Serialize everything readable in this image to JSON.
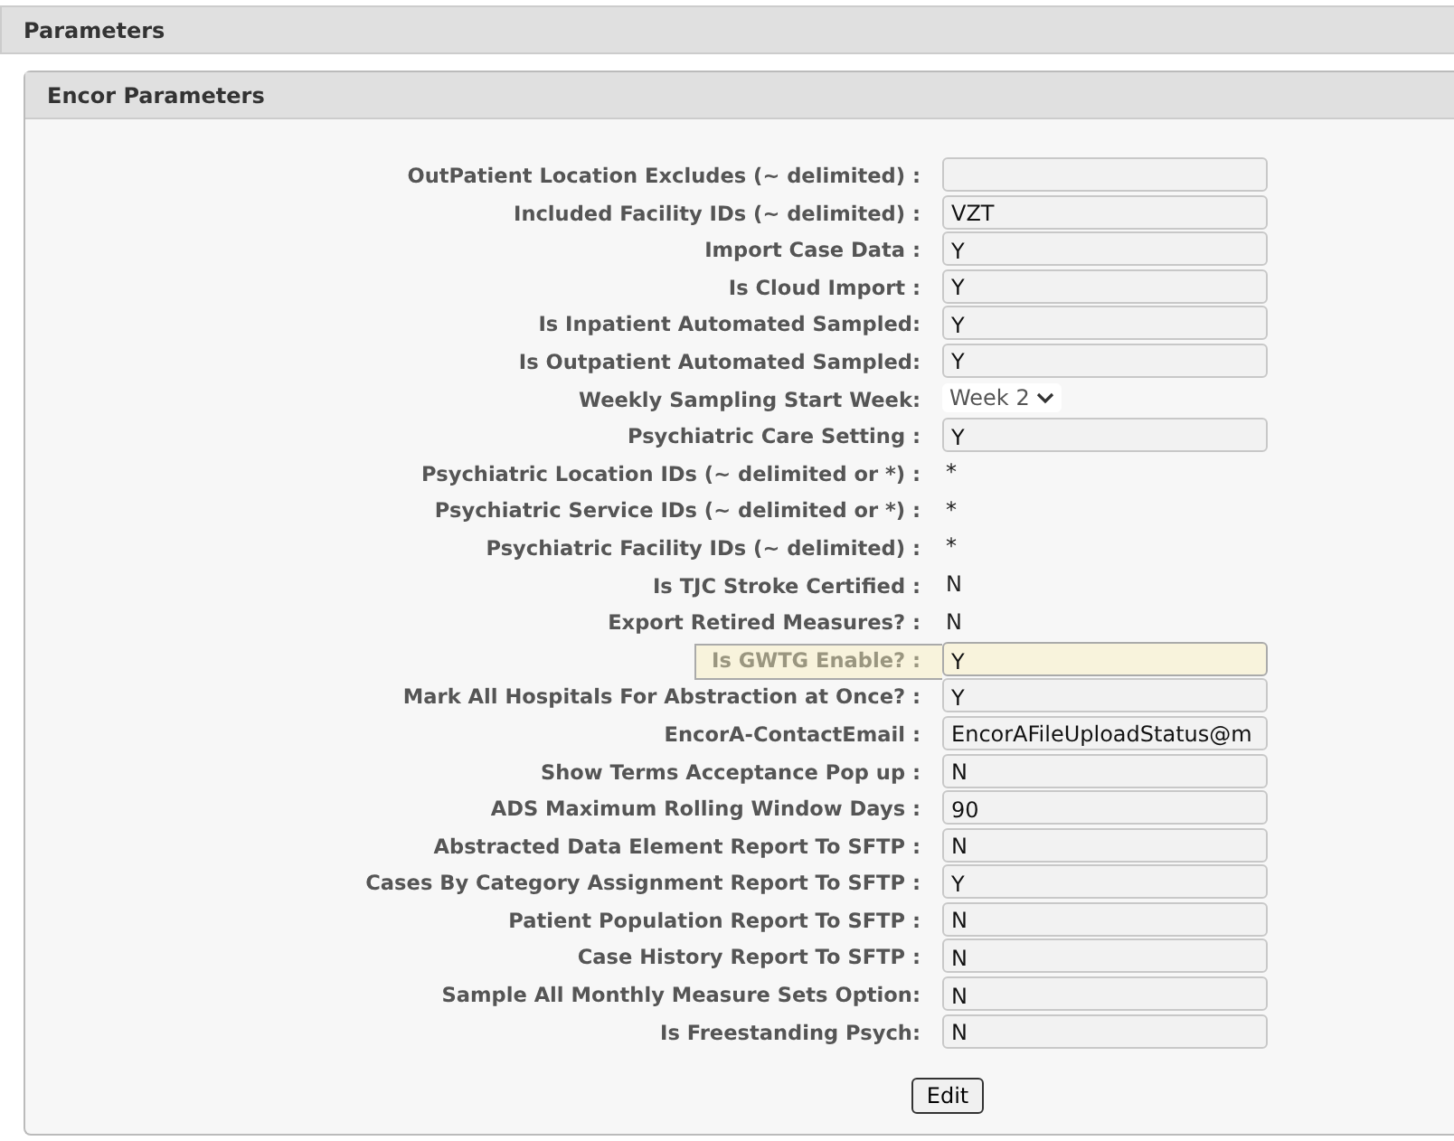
{
  "page_title": "Parameters",
  "panel": {
    "title": "Encor Parameters",
    "rows": [
      {
        "label": "OutPatient Location Excludes (~ delimited) :",
        "kind": "input",
        "value": "",
        "highlighted": false
      },
      {
        "label": "Included Facility IDs (~ delimited) :",
        "kind": "input",
        "value": "VZT",
        "highlighted": false
      },
      {
        "label": "Import Case Data :",
        "kind": "input",
        "value": "Y",
        "highlighted": false
      },
      {
        "label": "Is Cloud Import :",
        "kind": "input",
        "value": "Y",
        "highlighted": false
      },
      {
        "label": "Is Inpatient Automated Sampled:",
        "kind": "input",
        "value": "Y",
        "highlighted": false
      },
      {
        "label": "Is Outpatient Automated Sampled:",
        "kind": "input",
        "value": "Y",
        "highlighted": false
      },
      {
        "label": "Weekly Sampling Start Week:",
        "kind": "select",
        "value": "Week 2",
        "highlighted": false
      },
      {
        "label": "Psychiatric Care Setting :",
        "kind": "input",
        "value": "Y",
        "highlighted": false
      },
      {
        "label": "Psychiatric Location IDs (~ delimited or *) :",
        "kind": "text",
        "value": "*",
        "highlighted": false
      },
      {
        "label": "Psychiatric Service IDs (~ delimited or *) :",
        "kind": "text",
        "value": "*",
        "highlighted": false
      },
      {
        "label": "Psychiatric Facility IDs (~ delimited) :",
        "kind": "text",
        "value": "*",
        "highlighted": false
      },
      {
        "label": "Is TJC Stroke Certified :",
        "kind": "text",
        "value": "N",
        "highlighted": false
      },
      {
        "label": "Export Retired Measures? :",
        "kind": "text",
        "value": "N",
        "highlighted": false
      },
      {
        "label": "Is GWTG Enable? :",
        "kind": "input",
        "value": "Y",
        "highlighted": true
      },
      {
        "label": "Mark All Hospitals For Abstraction at Once? :",
        "kind": "input",
        "value": "Y",
        "highlighted": false
      },
      {
        "label": "EncorA-ContactEmail :",
        "kind": "input",
        "value": "EncorAFileUploadStatus@m",
        "highlighted": false
      },
      {
        "label": "Show Terms Acceptance Pop up :",
        "kind": "input",
        "value": "N",
        "highlighted": false
      },
      {
        "label": "ADS Maximum Rolling Window Days :",
        "kind": "input",
        "value": "90",
        "highlighted": false
      },
      {
        "label": "Abstracted Data Element Report To SFTP :",
        "kind": "input",
        "value": "N",
        "highlighted": false
      },
      {
        "label": "Cases By Category Assignment Report To SFTP :",
        "kind": "input",
        "value": "Y",
        "highlighted": false
      },
      {
        "label": "Patient Population Report To SFTP :",
        "kind": "input",
        "value": "N",
        "highlighted": false
      },
      {
        "label": "Case History Report To SFTP :",
        "kind": "input",
        "value": "N",
        "highlighted": false
      },
      {
        "label": "Sample All Monthly Measure Sets Option:",
        "kind": "input",
        "value": "N",
        "highlighted": false
      },
      {
        "label": "Is Freestanding Psych:",
        "kind": "input",
        "value": "N",
        "highlighted": false
      }
    ],
    "button": "Edit"
  }
}
